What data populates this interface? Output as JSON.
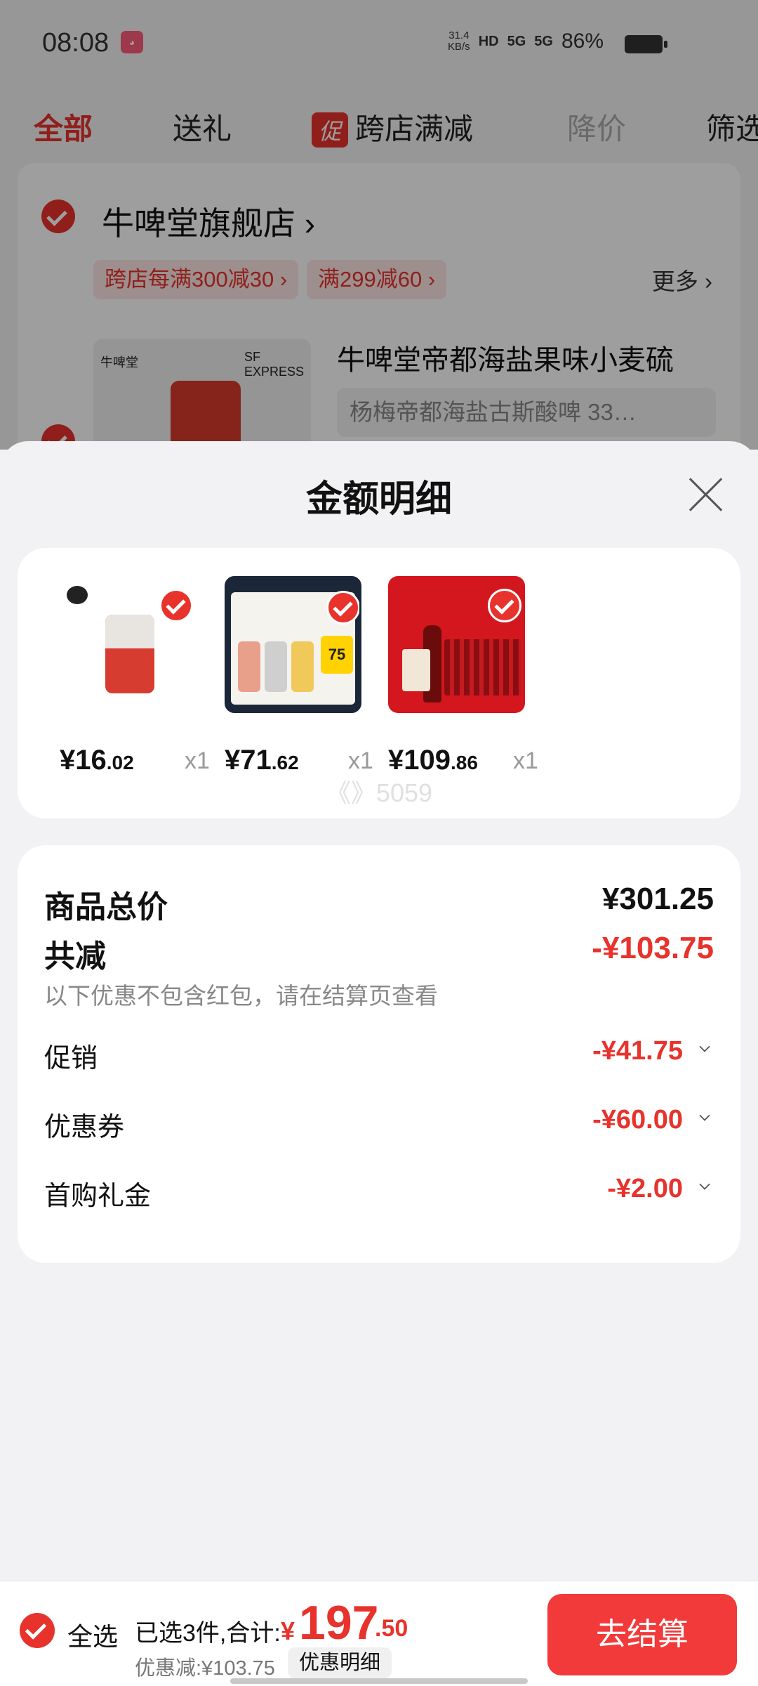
{
  "status_bar": {
    "time": "08:08",
    "net_speed_value": "31.4",
    "net_speed_unit": "KB/s",
    "hd": "HD",
    "signal1": "5G",
    "signal2": "5G",
    "battery": "86%"
  },
  "tabs": [
    {
      "label": "全部"
    },
    {
      "label": "送礼"
    },
    {
      "label": "跨店满减",
      "tag": "促"
    },
    {
      "label": "降价"
    },
    {
      "label": "筛选"
    }
  ],
  "store": {
    "name": "牛啤堂旗舰店",
    "coupons": [
      "跨店每满300减30 ›",
      "满299减60 ›"
    ],
    "more": "更多 ›",
    "thumb_brand": "牛啤堂",
    "thumb_courier": "SF EXPRESS",
    "product_title": "牛啤堂帝都海盐果味小麦硫",
    "variant": "杨梅帝都海盐古斯酸啤 33…"
  },
  "sheet": {
    "title": "金额明细",
    "items": [
      {
        "yen": "¥",
        "int": "16",
        "dec": ".02",
        "qty": "x1"
      },
      {
        "yen": "¥",
        "int": "71",
        "dec": ".62",
        "qty": "x1"
      },
      {
        "yen": "¥",
        "int": "109",
        "dec": ".86",
        "qty": "x1"
      }
    ],
    "item_badge_75": "75",
    "watermark": "《》5059",
    "summary": {
      "total_label": "商品总价",
      "total_value": "¥301.25",
      "minus_label": "共减",
      "minus_value": "-¥103.75",
      "note": "以下优惠不包含红包，请在结算页查看",
      "rows": [
        {
          "label": "促销",
          "value": "-¥41.75"
        },
        {
          "label": "优惠券",
          "value": "-¥60.00"
        },
        {
          "label": "首购礼金",
          "value": "-¥2.00"
        }
      ]
    }
  },
  "bottom_bar": {
    "select_all": "全选",
    "selected_text": "已选3件,合计:",
    "total_yen": "¥",
    "total_int": "197",
    "total_dec": ".50",
    "discount_text": "优惠减:¥103.75",
    "detail_button": "优惠明细",
    "checkout_button": "去结算"
  },
  "colors": {
    "accent": "#e8322c",
    "checkout": "#f23a3a",
    "background": "#f2f2f4"
  }
}
